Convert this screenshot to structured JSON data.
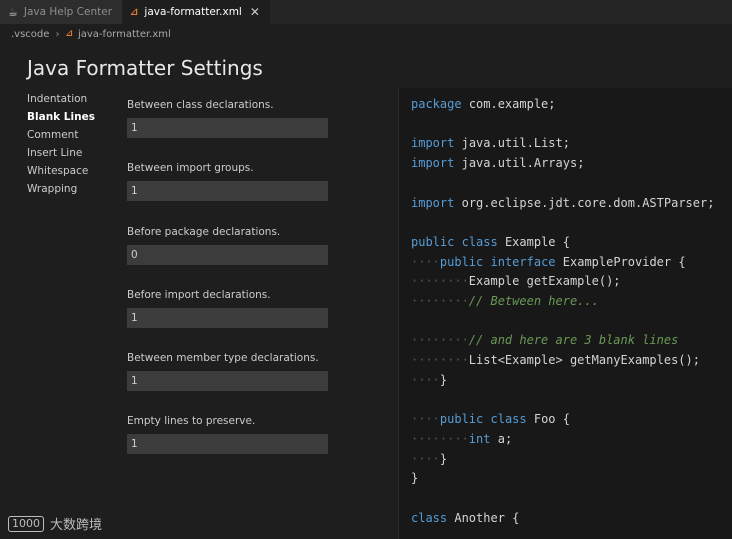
{
  "tabs": [
    {
      "label": "Java Help Center",
      "icon": "coffee-icon"
    },
    {
      "label": "java-formatter.xml",
      "icon": "rss-icon"
    }
  ],
  "breadcrumb": {
    "folder": ".vscode",
    "file": "java-formatter.xml"
  },
  "page_title": "Java Formatter Settings",
  "nav": [
    "Indentation",
    "Blank Lines",
    "Comment",
    "Insert Line",
    "Whitespace",
    "Wrapping"
  ],
  "nav_active": "Blank Lines",
  "fields": [
    {
      "label": "Between class declarations.",
      "value": "1"
    },
    {
      "label": "Between import groups.",
      "value": "1"
    },
    {
      "label": "Before package declarations.",
      "value": "0"
    },
    {
      "label": "Before import declarations.",
      "value": "1"
    },
    {
      "label": "Between member type declarations.",
      "value": "1"
    },
    {
      "label": "Empty lines to preserve.",
      "value": "1"
    }
  ],
  "code": {
    "package_kw": "package",
    "package_name": "com.example;",
    "import_kw": "import",
    "import1": "java.util.List;",
    "import2": "java.util.Arrays;",
    "import3": "org.eclipse.jdt.core.dom.ASTParser;",
    "public_kw": "public",
    "class_kw": "class",
    "interface_kw": "interface",
    "int_kw": "int",
    "class1": "Example {",
    "iface": "ExampleProvider {",
    "method1": "Example getExample();",
    "comment1": "// Between here...",
    "comment2": "// and here are 3 blank lines",
    "method2": "List<Example> getManyExamples();",
    "close": "}",
    "class2": "Foo {",
    "field": "a;",
    "class3": "Another {"
  },
  "watermark": {
    "logo": "1000",
    "text": "大数跨境"
  }
}
